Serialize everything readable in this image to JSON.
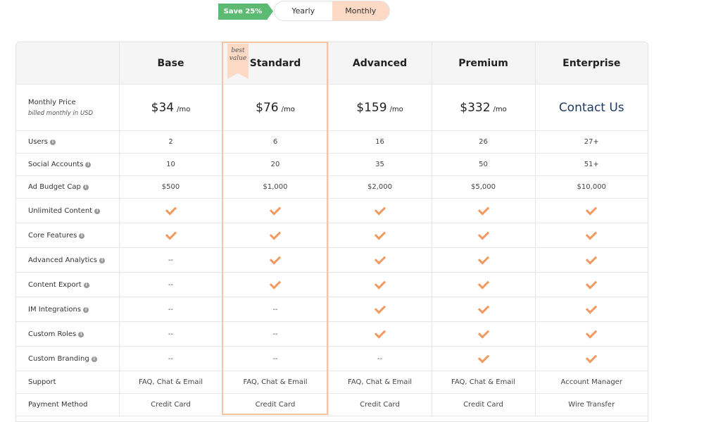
{
  "billing": {
    "save_badge": "Save 25%",
    "yearly": "Yearly",
    "monthly": "Monthly"
  },
  "plans": [
    {
      "name": "Base",
      "price": "$34",
      "unit": "/mo"
    },
    {
      "name": "Standard",
      "price": "$76",
      "unit": "/mo",
      "ribbon_top": "best",
      "ribbon_bottom": "value"
    },
    {
      "name": "Advanced",
      "price": "$159",
      "unit": "/mo"
    },
    {
      "name": "Premium",
      "price": "$332",
      "unit": "/mo"
    },
    {
      "name": "Enterprise",
      "contact": "Contact Us"
    }
  ],
  "price_row": {
    "label": "Monthly Price",
    "sub": "billed monthly in USD"
  },
  "rows": [
    {
      "label": "Users",
      "values": [
        "2",
        "6",
        "16",
        "26",
        "27+"
      ]
    },
    {
      "label": "Social Accounts",
      "values": [
        "10",
        "20",
        "35",
        "50",
        "51+"
      ]
    },
    {
      "label": "Ad Budget Cap",
      "values": [
        "$500",
        "$1,000",
        "$2,000",
        "$5,000",
        "$10,000"
      ]
    },
    {
      "label": "Unlimited Content",
      "checks": [
        true,
        true,
        true,
        true,
        true
      ]
    },
    {
      "label": "Core Features",
      "checks": [
        true,
        true,
        true,
        true,
        true
      ]
    },
    {
      "label": "Advanced Analytics",
      "checks": [
        false,
        true,
        true,
        true,
        true
      ]
    },
    {
      "label": "Content Export",
      "checks": [
        false,
        true,
        true,
        true,
        true
      ]
    },
    {
      "label": "IM Integrations",
      "checks": [
        false,
        false,
        true,
        true,
        true
      ]
    },
    {
      "label": "Custom Roles",
      "checks": [
        false,
        false,
        true,
        true,
        true
      ]
    },
    {
      "label": "Custom Branding",
      "checks": [
        false,
        false,
        false,
        true,
        true
      ]
    },
    {
      "label": "Support",
      "values": [
        "FAQ, Chat & Email",
        "FAQ, Chat & Email",
        "FAQ, Chat & Email",
        "FAQ, Chat & Email",
        "Account Manager"
      ]
    },
    {
      "label": "Payment Method",
      "values": [
        "Credit Card",
        "Credit Card",
        "Credit Card",
        "Credit Card",
        "Wire Transfer"
      ]
    }
  ],
  "no_feature": "--",
  "colors": {
    "accent": "#f2995f",
    "save_green": "#5dba72",
    "contact_blue": "#1e3a64",
    "highlight": "#fbd9c4"
  }
}
